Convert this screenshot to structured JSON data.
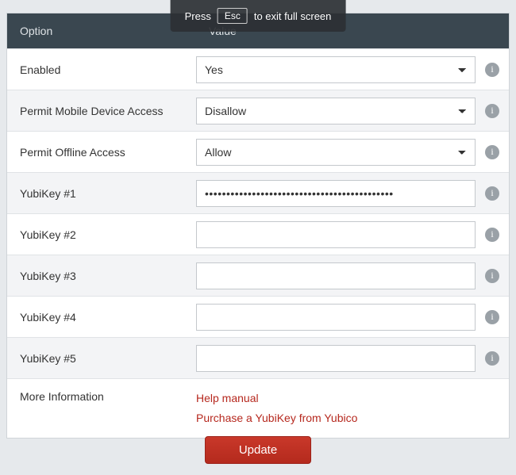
{
  "fs_hint": {
    "press": "Press",
    "key": "Esc",
    "rest": "to exit full screen"
  },
  "header": {
    "option": "Option",
    "value": "Value"
  },
  "rows": {
    "enabled_label": "Enabled",
    "enabled_value": "Yes",
    "mobile_label": "Permit Mobile Device Access",
    "mobile_value": "Disallow",
    "offline_label": "Permit Offline Access",
    "offline_value": "Allow",
    "yk1_label": "YubiKey #1",
    "yk1_value": "••••••••••••••••••••••••••••••••••••••••••••",
    "yk2_label": "YubiKey #2",
    "yk2_value": "",
    "yk3_label": "YubiKey #3",
    "yk3_value": "",
    "yk4_label": "YubiKey #4",
    "yk4_value": "",
    "yk5_label": "YubiKey #5",
    "yk5_value": "",
    "more_label": "More Information",
    "help_link": "Help manual",
    "purchase_link": "Purchase a YubiKey from Yubico"
  },
  "footer": {
    "update": "Update"
  }
}
